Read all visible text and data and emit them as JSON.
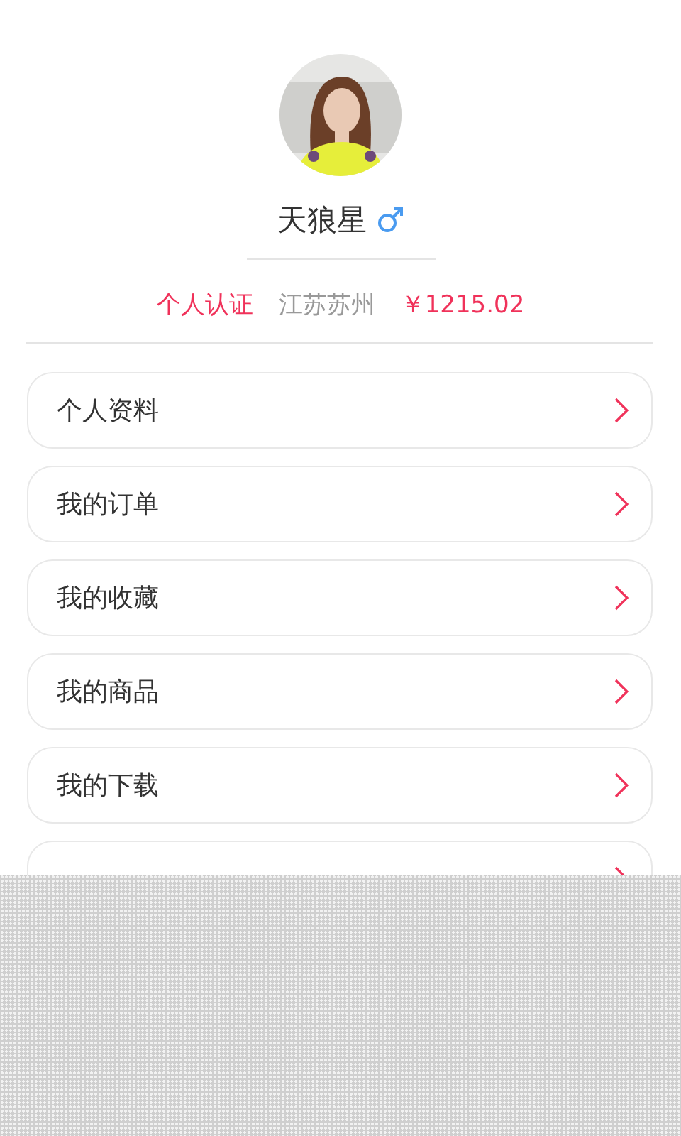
{
  "profile": {
    "name": "天狼星",
    "gender_mark": {
      "kind": "male"
    }
  },
  "info": [
    {
      "text": "个人认证",
      "kind": "accent"
    },
    {
      "text": "江苏苏州",
      "kind": "muted"
    },
    {
      "text": "￥1215.02",
      "kind": "accent"
    }
  ],
  "menu": [
    {
      "kind": "row",
      "label": "个人资料"
    },
    {
      "kind": "row",
      "label": "我的订单"
    },
    {
      "kind": "row",
      "label": "我的收藏"
    },
    {
      "kind": "row",
      "label": "我的商品"
    },
    {
      "kind": "row",
      "label": "我的下载"
    },
    {
      "kind": "covered"
    }
  ]
}
